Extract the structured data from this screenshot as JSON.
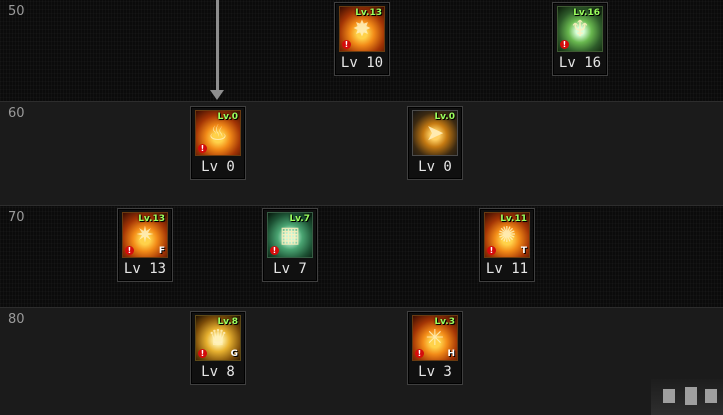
{
  "levels": [
    "50",
    "60",
    "70",
    "80"
  ],
  "skills": [
    {
      "level_text": "Lv 10",
      "badge": "Lv.13",
      "hotkey": "",
      "icon": "fire-burst-icon"
    },
    {
      "level_text": "Lv 16",
      "badge": "Lv.16",
      "hotkey": "",
      "icon": "green-claw-icon"
    },
    {
      "level_text": "Lv 0",
      "badge": "Lv.0",
      "hotkey": "",
      "icon": "flame-pillar-icon"
    },
    {
      "level_text": "Lv 0",
      "badge": "Lv.0",
      "hotkey": "",
      "icon": "golden-dash-icon"
    },
    {
      "level_text": "Lv 13",
      "badge": "Lv.13",
      "hotkey": "F",
      "icon": "fire-strike-icon"
    },
    {
      "level_text": "Lv 7",
      "badge": "Lv.7",
      "hotkey": "",
      "icon": "jade-tablet-icon"
    },
    {
      "level_text": "Lv 11",
      "badge": "Lv.11",
      "hotkey": "T",
      "icon": "fire-orb-icon"
    },
    {
      "level_text": "Lv 8",
      "badge": "Lv.8",
      "hotkey": "G",
      "icon": "fire-spikes-icon"
    },
    {
      "level_text": "Lv 3",
      "badge": "Lv.3",
      "hotkey": "H",
      "icon": "fire-star-icon"
    }
  ]
}
